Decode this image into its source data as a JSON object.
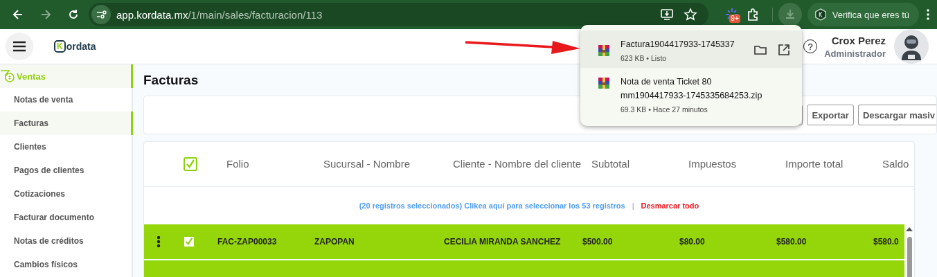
{
  "browser": {
    "url_host": "app.kordata.mx",
    "url_path": "/1/main/sales/facturacion/113",
    "extension_badge": "9+",
    "profile_label": "Verifica que eres tú"
  },
  "header": {
    "logo_letter": "K",
    "logo_text": "ordata",
    "help": "?",
    "user_name": "Crox Perez",
    "user_role": "Administrador"
  },
  "sidebar": {
    "section": "Ventas",
    "items": [
      {
        "label": "Notas de venta",
        "selected": false
      },
      {
        "label": "Facturas",
        "selected": true
      },
      {
        "label": "Clientes",
        "selected": false
      },
      {
        "label": "Pagos de clientes",
        "selected": false
      },
      {
        "label": "Cotizaciones",
        "selected": false
      },
      {
        "label": "Facturar documento",
        "selected": false
      },
      {
        "label": "Notas de créditos",
        "selected": false
      },
      {
        "label": "Cambios físicos",
        "selected": false
      }
    ]
  },
  "page_title": "Facturas",
  "toolbar_buttons": [
    "Exportar",
    "Descargar masiv"
  ],
  "table": {
    "all_checked": true,
    "columns": [
      "Folio",
      "Sucursal - Nombre",
      "Cliente - Nombre del cliente",
      "Subtotal",
      "Impuestos",
      "Importe total",
      "Saldo"
    ],
    "selection_info": "(20 registros seleccionados) Clikea aquí para seleccionar los 53 registros",
    "separator": "|",
    "unselect_link": "Desmarcar todo",
    "rows": [
      {
        "checked": true,
        "cells": [
          "FAC-ZAP00033",
          "ZAPOPAN",
          "CECILIA MIRANDA SANCHEZ",
          "$500.00",
          "$80.00",
          "$580.00",
          "$580.0"
        ]
      },
      {
        "checked": true,
        "cells": []
      }
    ]
  },
  "downloads": [
    {
      "selected": true,
      "name": "Factura1904417933-1745337",
      "detail": "623 KB • Listo"
    },
    {
      "selected": false,
      "name": "Nota de venta Ticket 80 mm1904417933-1745335684253.zip",
      "detail": "69.3 KB • Hace 27 minutos"
    }
  ]
}
